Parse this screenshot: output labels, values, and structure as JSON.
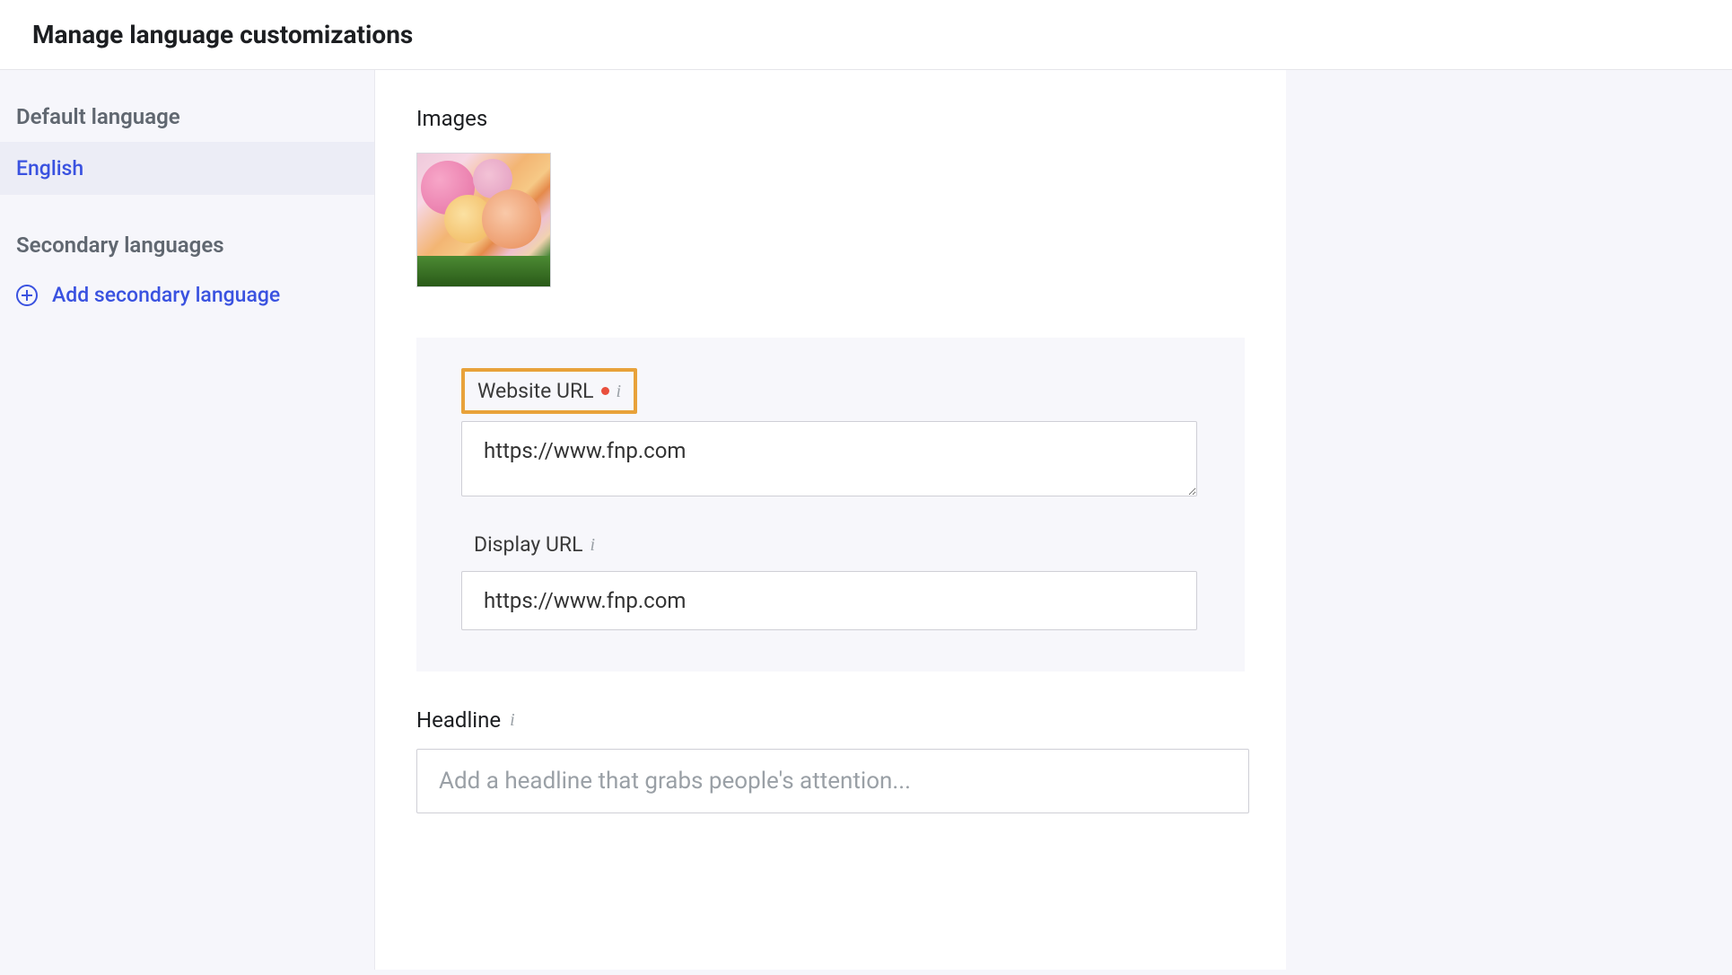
{
  "header": {
    "title": "Manage language customizations"
  },
  "sidebar": {
    "default_label": "Default language",
    "default_item": "English",
    "secondary_label": "Secondary languages",
    "add_label": "Add secondary language"
  },
  "main": {
    "images_label": "Images",
    "website_url": {
      "label": "Website URL",
      "value": "https://www.fnp.com",
      "required": true
    },
    "display_url": {
      "label": "Display URL",
      "value": "https://www.fnp.com"
    },
    "headline": {
      "label": "Headline",
      "placeholder": "Add a headline that grabs people's attention...",
      "value": ""
    }
  },
  "colors": {
    "accent": "#3a52e0",
    "highlight": "#e8a23a",
    "required_dot": "#e94f3d"
  }
}
